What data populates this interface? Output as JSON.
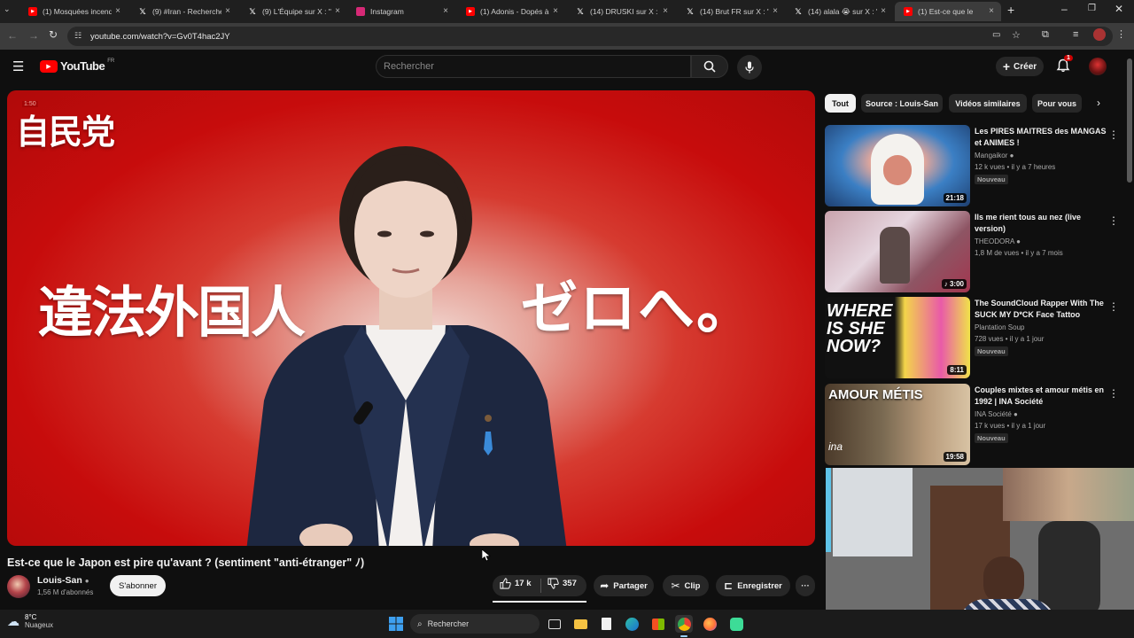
{
  "browser": {
    "tabs": [
      {
        "label": "(1) Mosquées incend",
        "icon": "youtube-icon",
        "color": "#ff0000"
      },
      {
        "label": "(9) #Iran - Recherche",
        "icon": "x-icon",
        "color": "#000000"
      },
      {
        "label": "(9) L'Équipe sur X : \"",
        "icon": "x-icon",
        "color": "#000000"
      },
      {
        "label": "Instagram",
        "icon": "instagram-icon",
        "color": "#d62976"
      },
      {
        "label": "(1) Adonis - Dopés à",
        "icon": "youtube-icon",
        "color": "#ff0000"
      },
      {
        "label": "(14) DRUSKI sur X : \"",
        "icon": "x-icon",
        "color": "#000000"
      },
      {
        "label": "(14) Brut FR sur X : \"",
        "icon": "x-icon",
        "color": "#000000"
      },
      {
        "label": "(14) alala 😭 sur X : \"",
        "icon": "x-icon",
        "color": "#000000"
      },
      {
        "label": "(1) Est-ce que le",
        "icon": "youtube-icon",
        "color": "#ff0000"
      }
    ],
    "url": "youtube.com/watch?v=Gv0T4hac2JY"
  },
  "youtube": {
    "logo_text": "YouTube",
    "logo_region": "FR",
    "search_placeholder": "Rechercher",
    "create_label": "Créer",
    "notification_count": "1"
  },
  "video": {
    "overlay_corner": "自民党",
    "overlay_left": "違法外国人",
    "overlay_right": "ゼロへ。",
    "small_tag": "1:50",
    "title": "Est-ce que le Japon est pire qu'avant ? (sentiment \"anti-étranger\" ﾉ)",
    "channel": "Louis-San",
    "subscribers": "1,56 M d'abonnés",
    "subscribe_label": "S'abonner",
    "likes": "17 k",
    "dislikes": "357",
    "share_label": "Partager",
    "clip_label": "Clip",
    "save_label": "Enregistrer"
  },
  "chips": [
    "Tout",
    "Source : Louis-San",
    "Vidéos similaires",
    "Pour vous"
  ],
  "recommendations": [
    {
      "title": "Les PIRES MAITRES des MANGAS et ANIMES !",
      "channel": "Mangaikor",
      "meta": "12 k vues • il y a 7 heures",
      "badge": "Nouveau",
      "duration": "21:18"
    },
    {
      "title": "Ils me rient tous au nez (live version)",
      "channel": "THEODORA",
      "meta": "1,8 M de vues • il y a 7 mois",
      "badge": "",
      "duration": "3:00"
    },
    {
      "title": "The SoundCloud Rapper With The SUCK MY D*CK Face Tattoo",
      "channel": "Plantation Soup",
      "meta": "728 vues • il y a 1 jour",
      "badge": "Nouveau",
      "duration": "8:11",
      "thumb_text": "WHERE IS SHE NOW?"
    },
    {
      "title": "Couples mixtes et amour métis en 1992 | INA Société",
      "channel": "INA Société",
      "meta": "17 k vues • il y a 1 jour",
      "badge": "Nouveau",
      "duration": "19:58",
      "thumb_text": "AMOUR MÉTIS",
      "thumb_logo": "ina"
    }
  ],
  "taskbar": {
    "weather_temp": "8°C",
    "weather_desc": "Nuageux",
    "search_label": "Rechercher"
  },
  "colors": {
    "youtube_red": "#ff0000",
    "page_bg": "#0f0f0f",
    "chrome_bg": "#3c3c3c"
  }
}
